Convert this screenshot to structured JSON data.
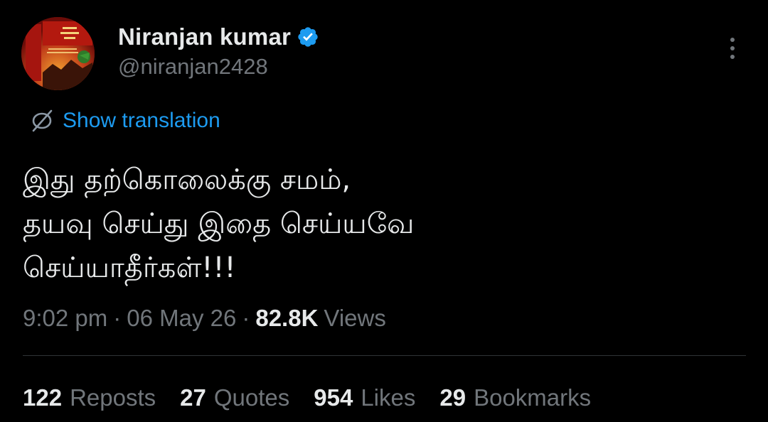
{
  "author": {
    "display_name": "Niranjan kumar",
    "handle": "@niranjan2428",
    "verified_icon": "verified-badge-icon",
    "avatar_icon": "book-cover-avatar"
  },
  "actions": {
    "more_icon": "more-vertical-icon"
  },
  "translation": {
    "icon": "globe-slash-icon",
    "label": "Show translation"
  },
  "tweet": {
    "text": "இது தற்கொலைக்கு சமம்,\nதயவு செய்து இதை செய்யவே\nசெய்யாதீர்கள்!!!"
  },
  "meta": {
    "time": "9:02 pm",
    "separator": "·",
    "date": "06 May 26",
    "views_count": "82.8K",
    "views_label": "Views"
  },
  "stats": [
    {
      "count": "122",
      "label": "Reposts"
    },
    {
      "count": "27",
      "label": "Quotes"
    },
    {
      "count": "954",
      "label": "Likes"
    },
    {
      "count": "29",
      "label": "Bookmarks"
    }
  ],
  "colors": {
    "background": "#000000",
    "primary_text": "#e7e9ea",
    "secondary_text": "#71767b",
    "accent": "#1d9bf0",
    "divider": "#2f3336"
  }
}
